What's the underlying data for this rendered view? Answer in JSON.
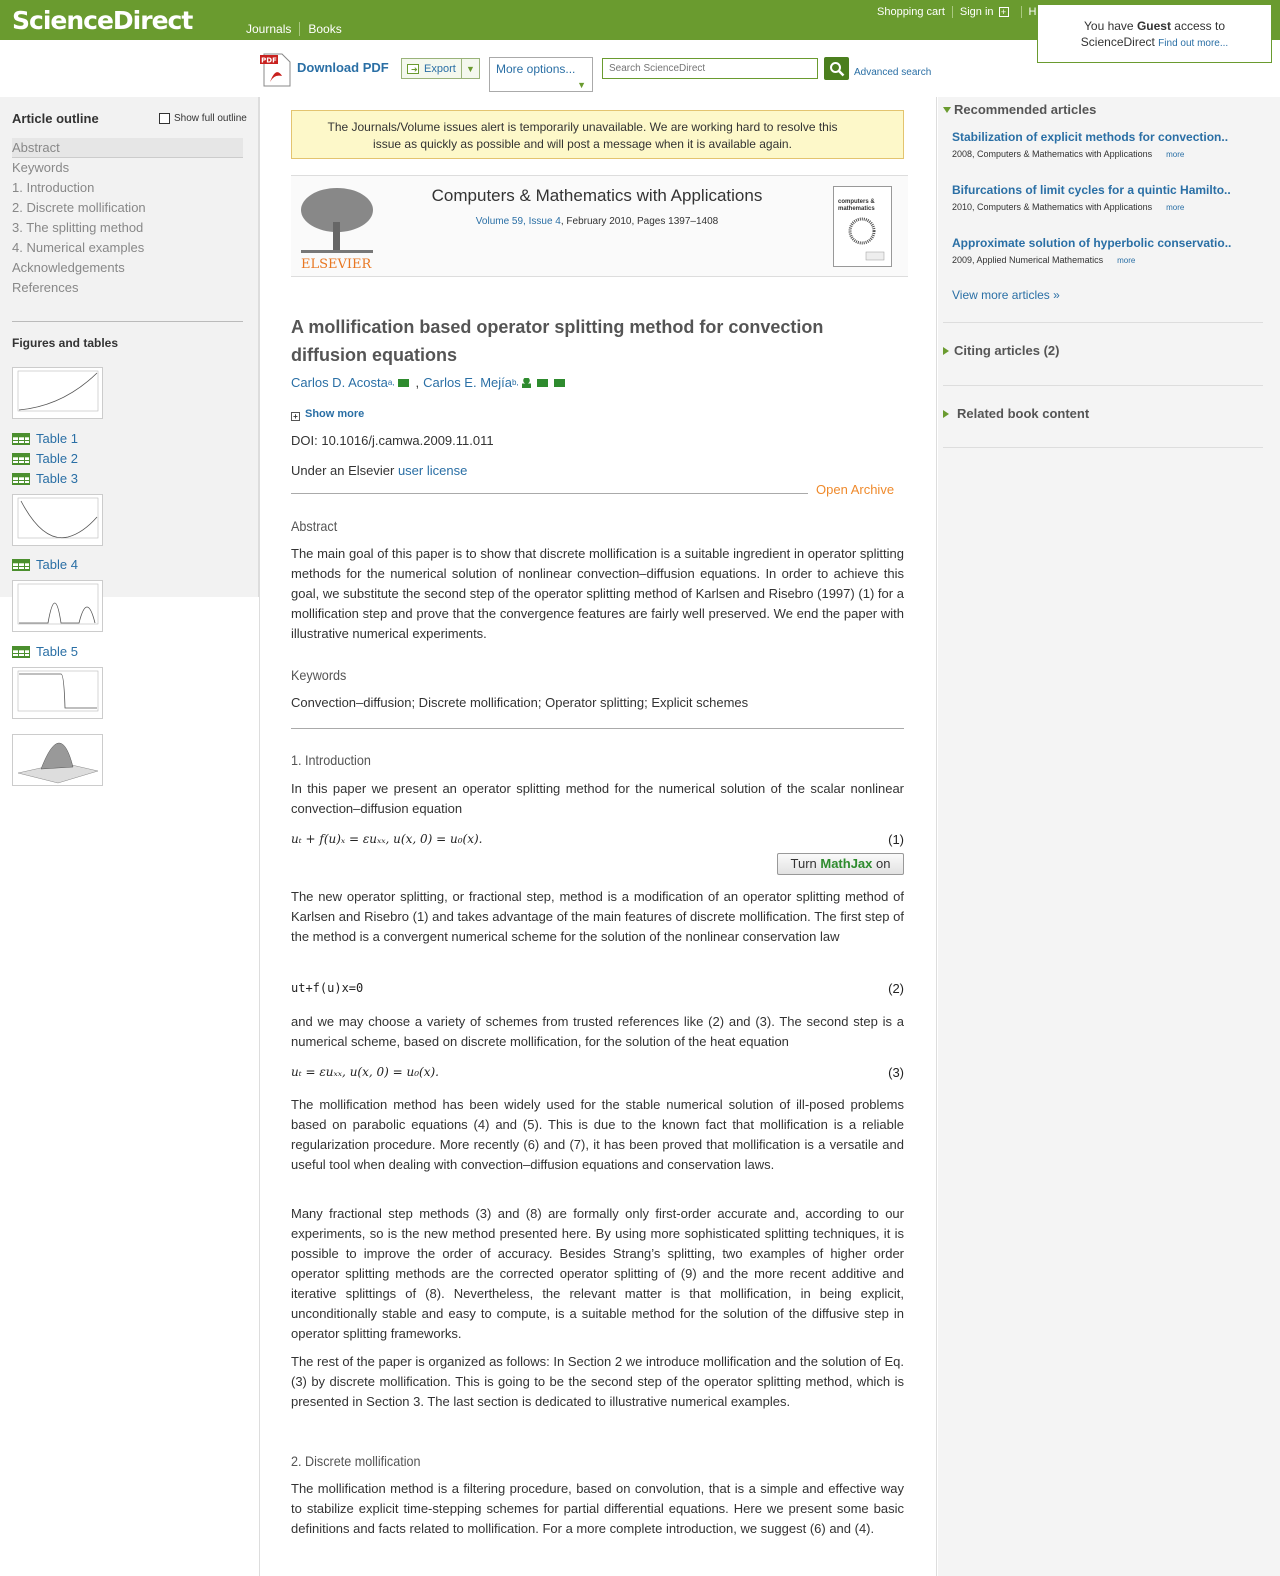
{
  "header": {
    "logo": "ScienceDirect",
    "nav": [
      "Journals",
      "Books"
    ],
    "links": {
      "cart": "Shopping cart",
      "signin": "Sign in",
      "help": "Help"
    },
    "guest": {
      "line1_pre": "You have ",
      "line1_bold": "Guest",
      "line1_post": " access to",
      "line2": "ScienceDirect ",
      "link": "Find out more..."
    }
  },
  "toolbar": {
    "download_pdf": "Download PDF",
    "pdf_badge": "PDF",
    "export": "Export",
    "more_options": "More options...",
    "search_placeholder": "Search ScienceDirect",
    "advanced": "Advanced search"
  },
  "sidebar": {
    "title": "Article outline",
    "show_full": "Show full outline",
    "outline": [
      "Abstract",
      "Keywords",
      "1. Introduction",
      "2. Discrete mollification",
      "3. The splitting method",
      "4. Numerical examples",
      "Acknowledgements",
      "References"
    ],
    "figures_title": "Figures and tables",
    "tables": [
      "Table 1",
      "Table 2",
      "Table 3",
      "Table 4",
      "Table 5"
    ]
  },
  "alert": "The Journals/Volume issues alert is temporarily unavailable. We are working hard to resolve this issue as quickly as possible and will post a message when it is available again.",
  "journal": {
    "publisher": "ELSEVIER",
    "title": "Computers & Mathematics with Applications",
    "volume_link": "Volume 59, Issue 4",
    "volume_rest": ", February 2010, Pages 1397–1408",
    "cover_text": "computers & mathematics"
  },
  "article": {
    "title": "A mollification based operator splitting method for convection diffusion equations",
    "author1": "Carlos D. Acosta",
    "author1_sup": "a,",
    "author2": "Carlos E. Mejía",
    "author2_sup": "b,",
    "show_more": "Show more",
    "doi": "DOI:  10.1016/j.camwa.2009.11.011",
    "license_pre": "Under an Elsevier ",
    "license_link": "user license",
    "open_archive": "Open Archive"
  },
  "abstract": {
    "heading": "Abstract",
    "text": "The main goal of this paper is to show that discrete mollification is a suitable ingredient in operator splitting methods for the numerical solution of nonlinear convection–diffusion equations. In order to achieve this goal, we substitute the second step of the operator splitting method of Karlsen and Risebro (1997) (1) for a mollification step and prove that the convergence features are fairly well preserved. We end the paper with illustrative numerical experiments."
  },
  "keywords": {
    "heading": "Keywords",
    "text": "Convection–diffusion; Discrete mollification; Operator splitting; Explicit schemes"
  },
  "intro": {
    "heading": "1. Introduction",
    "p1": "In this paper we present an operator splitting method for the numerical solution of the scalar nonlinear convection–diffusion equation",
    "eq1": "uₜ + f(u)ₓ = εuₓₓ,    u(x, 0) = u₀(x).",
    "eq1_num": "(1)",
    "mathjax_pre": "Turn ",
    "mathjax_brand": "MathJax",
    "mathjax_post": " on",
    "p2": "The new operator splitting, or fractional step, method is a modification of an operator splitting method of Karlsen and Risebro (1) and takes advantage of the main features of discrete mollification. The first step of the method is a convergent numerical scheme for the solution of the nonlinear conservation law",
    "eq2": "ut+f(u)x=0",
    "eq2_num": "(2)",
    "p3": "and we may choose a variety of schemes from trusted references like (2) and (3). The second step is a numerical scheme, based on discrete mollification, for the solution of the heat equation",
    "eq3": "uₜ = εuₓₓ,    u(x, 0) = u₀(x).",
    "eq3_num": "(3)",
    "p4": "The mollification method has been widely used for the stable numerical solution of ill-posed problems based on parabolic equations (4) and (5). This is due to the known fact that mollification is a reliable regularization procedure. More recently (6) and (7), it has been proved that mollification is a versatile and useful tool when dealing with convection–diffusion equations and conservation laws.",
    "p5": "Many fractional step methods (3) and (8) are formally only first-order accurate and, according to our experiments, so is the new method presented here. By using more sophisticated splitting techniques, it is possible to improve the order of accuracy. Besides Strang’s splitting, two examples of higher order operator splitting methods are the corrected operator splitting of (9) and the more recent additive and iterative splittings of (8). Nevertheless, the relevant matter is that mollification, in being explicit, unconditionally stable and easy to compute, is a suitable method for the solution of the diffusive step in operator splitting frameworks.",
    "p6": "The rest of the paper is organized as follows: In Section 2 we introduce mollification and the solution of Eq. (3) by discrete mollification. This is going to be the second step of the operator splitting method, which is presented in Section 3. The last section is dedicated to illustrative numerical examples."
  },
  "section2": {
    "heading": "2. Discrete mollification",
    "p1": "The mollification method is a filtering procedure, based on convolution, that is a simple and effective way to stabilize explicit time-stepping schemes for partial differential equations. Here we present some basic definitions and facts related to mollification. For a more complete introduction, we suggest (6) and (4)."
  },
  "right": {
    "recommended": "Recommended articles",
    "items": [
      {
        "title": "Stabilization of explicit methods for convection..",
        "meta": "2008, Computers & Mathematics with Applications",
        "more": "more"
      },
      {
        "title": "Bifurcations of limit cycles for a quintic Hamilto..",
        "meta": "2010, Computers & Mathematics with Applications",
        "more": "more"
      },
      {
        "title": "Approximate solution of hyperbolic conservatio..",
        "meta": "2009, Applied Numerical Mathematics",
        "more": "more"
      }
    ],
    "view_more": "View more articles »",
    "citing": "Citing articles (2)",
    "related": "Related book content"
  }
}
